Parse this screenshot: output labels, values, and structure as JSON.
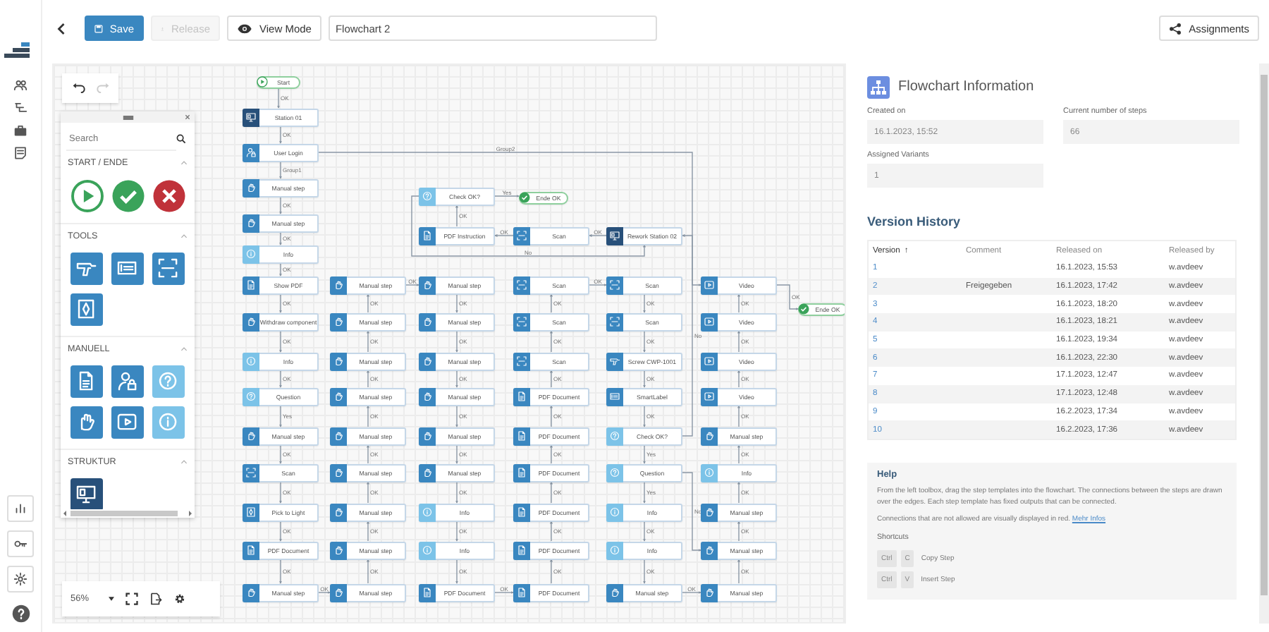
{
  "top_bar": {
    "save": {
      "label": "Save"
    },
    "release": {
      "label": "Release",
      "disabled": true
    },
    "view_mode": {
      "label": "View Mode"
    },
    "title_field": {
      "value": "Flowchart 2"
    },
    "assignments": {
      "label": "Assignments"
    }
  },
  "toolbox": {
    "search": {
      "placeholder": "Search"
    },
    "sections": [
      {
        "title": "START / ENDE",
        "expanded": true,
        "items": [
          {
            "kind": "start"
          },
          {
            "kind": "end_ok"
          },
          {
            "kind": "end_fail"
          }
        ]
      },
      {
        "title": "TOOLS",
        "expanded": true,
        "items": [
          {
            "kind": "screw"
          },
          {
            "kind": "label"
          },
          {
            "kind": "scan"
          },
          {
            "kind": "pick"
          }
        ]
      },
      {
        "title": "MANUELL",
        "expanded": true,
        "items": [
          {
            "kind": "pdf"
          },
          {
            "kind": "login"
          },
          {
            "kind": "question"
          },
          {
            "kind": "manual"
          },
          {
            "kind": "video"
          },
          {
            "kind": "info"
          }
        ]
      },
      {
        "title": "STRUKTUR",
        "expanded": true,
        "items": [
          {
            "kind": "station"
          }
        ]
      }
    ]
  },
  "zoom_bar": {
    "zoom": "56%"
  },
  "flowchart": {
    "nodes": [
      {
        "kind": "start",
        "label": "Start"
      },
      {
        "kind": "station",
        "label": "Station 01"
      },
      {
        "kind": "login",
        "label": "User Login"
      },
      {
        "kind": "manual",
        "label": "Manual step"
      },
      {
        "kind": "manual",
        "label": "Manual step"
      },
      {
        "kind": "info",
        "label": "Info"
      },
      {
        "kind": "pdf",
        "label": "Show PDF"
      },
      {
        "kind": "manual",
        "label": "Withdraw component"
      },
      {
        "kind": "info",
        "label": "Info"
      },
      {
        "kind": "question",
        "label": "Question"
      },
      {
        "kind": "manual",
        "label": "Manual step"
      },
      {
        "kind": "scan",
        "label": "Scan"
      },
      {
        "kind": "pick",
        "label": "Pick to Light"
      },
      {
        "kind": "pdf",
        "label": "PDF Document"
      },
      {
        "kind": "manual",
        "label": "Manual step"
      },
      {
        "kind": "manual",
        "label": "Manual step"
      },
      {
        "kind": "manual",
        "label": "Manual step"
      },
      {
        "kind": "manual",
        "label": "Manual step"
      },
      {
        "kind": "manual",
        "label": "Manual step"
      },
      {
        "kind": "manual",
        "label": "Manual step"
      },
      {
        "kind": "manual",
        "label": "Manual step"
      },
      {
        "kind": "manual",
        "label": "Manual step"
      },
      {
        "kind": "manual",
        "label": "Manual step"
      },
      {
        "kind": "manual",
        "label": "Manual step"
      },
      {
        "kind": "manual",
        "label": "Manual step"
      },
      {
        "kind": "manual",
        "label": "Manual step"
      },
      {
        "kind": "manual",
        "label": "Manual step"
      },
      {
        "kind": "manual",
        "label": "Manual step"
      },
      {
        "kind": "manual",
        "label": "Manual step"
      },
      {
        "kind": "manual",
        "label": "Manual step"
      },
      {
        "kind": "info",
        "label": "Info"
      },
      {
        "kind": "info",
        "label": "Info"
      },
      {
        "kind": "pdf",
        "label": "PDF Document"
      },
      {
        "kind": "scan",
        "label": "Scan"
      },
      {
        "kind": "scan",
        "label": "Scan"
      },
      {
        "kind": "scan",
        "label": "Scan"
      },
      {
        "kind": "pdf",
        "label": "PDF Document"
      },
      {
        "kind": "pdf",
        "label": "PDF Document"
      },
      {
        "kind": "pdf",
        "label": "PDF Document"
      },
      {
        "kind": "pdf",
        "label": "PDF Document"
      },
      {
        "kind": "pdf",
        "label": "PDF Document"
      },
      {
        "kind": "pdf",
        "label": "PDF Document"
      },
      {
        "kind": "scan",
        "label": "Scan"
      },
      {
        "kind": "scan",
        "label": "Scan"
      },
      {
        "kind": "screw",
        "label": "Screw CWP-1001"
      },
      {
        "kind": "label",
        "label": "SmartLabel"
      },
      {
        "kind": "question",
        "label": "Check OK?"
      },
      {
        "kind": "question",
        "label": "Question"
      },
      {
        "kind": "info",
        "label": "Info"
      },
      {
        "kind": "info",
        "label": "Info"
      },
      {
        "kind": "manual",
        "label": "Manual step"
      },
      {
        "kind": "video",
        "label": "Video"
      },
      {
        "kind": "video",
        "label": "Video"
      },
      {
        "kind": "video",
        "label": "Video"
      },
      {
        "kind": "video",
        "label": "Video"
      },
      {
        "kind": "manual",
        "label": "Manual step"
      },
      {
        "kind": "info",
        "label": "Info"
      },
      {
        "kind": "manual",
        "label": "Manual step"
      },
      {
        "kind": "manual",
        "label": "Manual step"
      },
      {
        "kind": "manual",
        "label": "Manual step"
      },
      {
        "kind": "end_ok",
        "label": "Ende OK"
      },
      {
        "kind": "question",
        "label": "Check OK?"
      },
      {
        "kind": "end_ok",
        "label": "Ende OK"
      },
      {
        "kind": "pdf",
        "label": "PDF Instruction"
      },
      {
        "kind": "scan",
        "label": "Scan"
      },
      {
        "kind": "station",
        "label": "Rework Station 02"
      }
    ],
    "connectors": [
      {
        "label": "OK"
      },
      {
        "label": "OK"
      },
      {
        "label": "Group1"
      },
      {
        "label": "OK"
      },
      {
        "label": "OK"
      },
      {
        "label": "OK"
      },
      {
        "label": "OK"
      },
      {
        "label": "OK"
      },
      {
        "label": "OK"
      },
      {
        "label": "Yes"
      },
      {
        "label": "OK"
      },
      {
        "label": "OK"
      },
      {
        "label": "OK"
      },
      {
        "label": "OK"
      },
      {
        "label": "OK"
      },
      {
        "label": "OK"
      },
      {
        "label": "OK"
      },
      {
        "label": "OK"
      },
      {
        "label": "OK"
      },
      {
        "label": "OK"
      },
      {
        "label": "OK"
      },
      {
        "label": "OK"
      },
      {
        "label": "OK"
      },
      {
        "label": "OK"
      },
      {
        "label": "OK"
      },
      {
        "label": "OK"
      },
      {
        "label": "OK"
      },
      {
        "label": "OK"
      },
      {
        "label": "OK"
      },
      {
        "label": "OK"
      },
      {
        "label": "OK"
      },
      {
        "label": "OK"
      },
      {
        "label": "OK"
      },
      {
        "label": "OK"
      },
      {
        "label": "OK"
      },
      {
        "label": "OK"
      },
      {
        "label": "OK"
      },
      {
        "label": "OK"
      },
      {
        "label": "OK"
      },
      {
        "label": "OK"
      },
      {
        "label": "OK"
      },
      {
        "label": "OK"
      },
      {
        "label": "OK"
      },
      {
        "label": "OK"
      },
      {
        "label": "OK"
      },
      {
        "label": "OK"
      },
      {
        "label": "Yes"
      },
      {
        "label": "Yes"
      },
      {
        "label": "OK"
      },
      {
        "label": "OK"
      },
      {
        "label": "No"
      },
      {
        "label": "No"
      },
      {
        "label": "OK"
      },
      {
        "label": "OK"
      },
      {
        "label": "OK"
      },
      {
        "label": "OK"
      },
      {
        "label": "OK"
      },
      {
        "label": "OK"
      },
      {
        "label": "OK"
      },
      {
        "label": "OK"
      },
      {
        "label": "OK"
      },
      {
        "label": "OK"
      },
      {
        "label": "Group2"
      },
      {
        "label": "OK"
      },
      {
        "label": "OK"
      },
      {
        "label": "OK"
      },
      {
        "label": "Yes"
      },
      {
        "label": "No"
      }
    ]
  },
  "info_panel": {
    "title": "Flowchart Information",
    "fields": [
      {
        "label": "Created on",
        "value": "16.1.2023, 15:52"
      },
      {
        "label": "Current number of steps",
        "value": "66"
      },
      {
        "label": "Assigned Variants",
        "value": "1"
      }
    ],
    "version_history": {
      "title": "Version History",
      "columns": [
        {
          "label": "Version",
          "sort_indicator": "↑"
        },
        {
          "label": "Comment"
        },
        {
          "label": "Released on"
        },
        {
          "label": "Released by"
        }
      ],
      "rows": [
        {
          "version": "1",
          "comment": "",
          "released_on": "16.1.2023, 15:53",
          "released_by": "w.avdeev"
        },
        {
          "version": "2",
          "comment": "Freigegeben",
          "released_on": "16.1.2023, 17:42",
          "released_by": "w.avdeev"
        },
        {
          "version": "3",
          "comment": "",
          "released_on": "16.1.2023, 18:20",
          "released_by": "w.avdeev"
        },
        {
          "version": "4",
          "comment": "",
          "released_on": "16.1.2023, 18:21",
          "released_by": "w.avdeev"
        },
        {
          "version": "5",
          "comment": "",
          "released_on": "16.1.2023, 19:34",
          "released_by": "w.avdeev"
        },
        {
          "version": "6",
          "comment": "",
          "released_on": "16.1.2023, 22:30",
          "released_by": "w.avdeev"
        },
        {
          "version": "7",
          "comment": "",
          "released_on": "17.1.2023, 12:47",
          "released_by": "w.avdeev"
        },
        {
          "version": "8",
          "comment": "",
          "released_on": "17.1.2023, 12:48",
          "released_by": "w.avdeev"
        },
        {
          "version": "9",
          "comment": "",
          "released_on": "16.2.2023, 17:34",
          "released_by": "w.avdeev"
        },
        {
          "version": "10",
          "comment": "",
          "released_on": "16.2.2023, 17:36",
          "released_by": "w.avdeev"
        }
      ]
    },
    "help": {
      "title": "Help",
      "text": "From the left toolbox, drag the step templates into the flowchart. The connections between the steps are drawn over the edges. Each step template has fixed outputs that can be connected.",
      "note": "Connections that are not allowed are visually displayed in red.",
      "link": "Mehr Infos",
      "shortcuts_title": "Shortcuts",
      "shortcuts": [
        {
          "keys": [
            "Ctrl",
            "C"
          ],
          "action": "Copy Step"
        },
        {
          "keys": [
            "Ctrl",
            "V"
          ],
          "action": "Insert Step"
        }
      ]
    }
  }
}
